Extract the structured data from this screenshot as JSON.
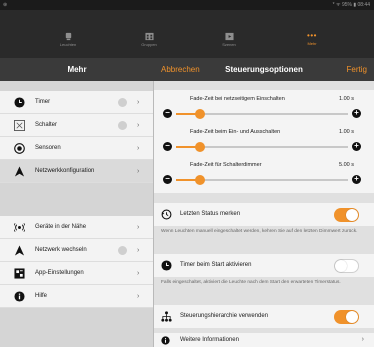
{
  "status_bar": {
    "left_glyph": "⊛",
    "right_text": "* ᯤ 95% ▮ 08:44"
  },
  "tabs": [
    {
      "label": "Leuchten",
      "icon": "bulb-icon"
    },
    {
      "label": "Gruppen",
      "icon": "group-icon"
    },
    {
      "label": "Szenen",
      "icon": "scene-icon"
    },
    {
      "label": "Mehr",
      "icon": "more-dots-icon",
      "glyph": "•••"
    }
  ],
  "left_header": {
    "title": "Mehr"
  },
  "right_header": {
    "cancel": "Abbrechen",
    "title": "Steuerungsoptionen",
    "done": "Fertig"
  },
  "menu": [
    {
      "label": "Timer",
      "icon": "clock-icon",
      "badge": true,
      "chevron": "›"
    },
    {
      "label": "Schalter",
      "icon": "switch-icon",
      "badge": true,
      "chevron": "›"
    },
    {
      "label": "Sensoren",
      "icon": "sensor-icon",
      "badge": false,
      "chevron": "›"
    },
    {
      "label": "Netzwerkkonfiguration",
      "icon": "navigate-icon",
      "badge": false,
      "chevron": "›"
    },
    {
      "label": "Geräte in der Nähe",
      "icon": "nearby-icon",
      "badge": false,
      "chevron": "›"
    },
    {
      "label": "Netzwerk wechseln",
      "icon": "navigate-icon",
      "badge": true,
      "chevron": "›"
    },
    {
      "label": "App-Einstellungen",
      "icon": "app-settings-icon",
      "badge": false,
      "chevron": "›"
    },
    {
      "label": "Hilfe",
      "icon": "info-icon",
      "badge": false,
      "chevron": "›"
    }
  ],
  "sliders": [
    {
      "label": "Fade-Zeit bei netzseitigem Einschalten",
      "value": "1.00 s",
      "fraction": 0.14
    },
    {
      "label": "Fade-Zeit beim Ein- und Ausschalten",
      "value": "1.00 s",
      "fraction": 0.14
    },
    {
      "label": "Fade-Zeit für Schalterdimmer",
      "value": "5.00 s",
      "fraction": 0.14
    }
  ],
  "options": [
    {
      "label": "Letzten Status merken",
      "on": true,
      "icon": "history-icon",
      "note": "Wenn Leuchten manuell eingeschaltet werden, kehren Sie auf den letzten Dimmwert zurück."
    },
    {
      "label": "Timer beim Start aktivieren",
      "on": false,
      "icon": "clock-icon",
      "note": "Falls eingeschaltet, aktiviert die Leuchte nach dem Start den erwarteten Timerstatus."
    },
    {
      "label": "Steuerungshierarchie verwenden",
      "on": true,
      "icon": "hierarchy-icon",
      "note": ""
    }
  ],
  "info_row": {
    "label": "Weitere Informationen",
    "chevron": "›",
    "icon": "info-icon"
  },
  "colors": {
    "accent": "#f0922b",
    "header": "#3a3a3a",
    "tabbar": "#2a2a2a"
  }
}
